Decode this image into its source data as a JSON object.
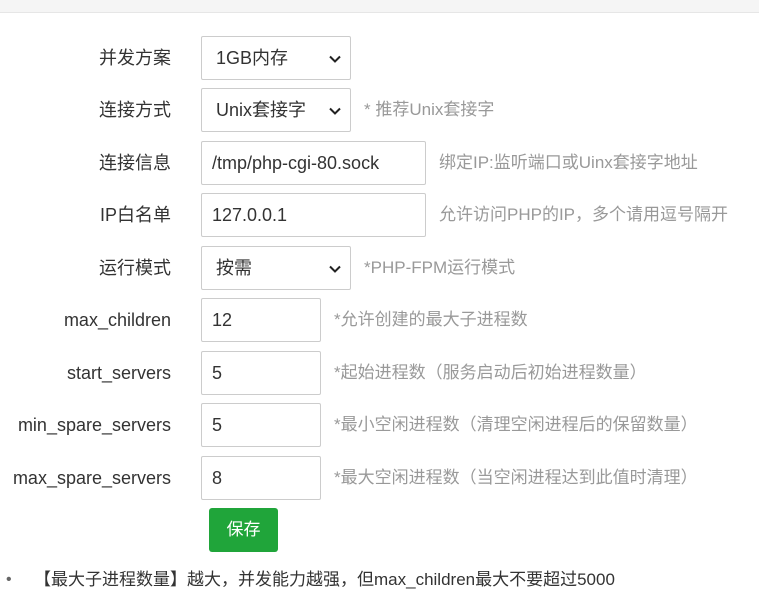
{
  "form": {
    "concurrency": {
      "label": "并发方案",
      "value": "1GB内存"
    },
    "connection_method": {
      "label": "连接方式",
      "value": "Unix套接字",
      "hint": "* 推荐Unix套接字"
    },
    "connection_info": {
      "label": "连接信息",
      "value": "/tmp/php-cgi-80.sock",
      "hint": "绑定IP:监听端口或Uinx套接字地址"
    },
    "ip_whitelist": {
      "label": "IP白名单",
      "value": "127.0.0.1",
      "hint": "允许访问PHP的IP，多个请用逗号隔开"
    },
    "run_mode": {
      "label": "运行模式",
      "value": "按需",
      "hint": "*PHP-FPM运行模式"
    },
    "max_children": {
      "label": "max_children",
      "value": "12",
      "hint": "*允许创建的最大子进程数"
    },
    "start_servers": {
      "label": "start_servers",
      "value": "5",
      "hint": "*起始进程数（服务启动后初始进程数量）"
    },
    "min_spare_servers": {
      "label": "min_spare_servers",
      "value": "5",
      "hint": "*最小空闲进程数（清理空闲进程后的保留数量）"
    },
    "max_spare_servers": {
      "label": "max_spare_servers",
      "value": "8",
      "hint": "*最大空闲进程数（当空闲进程达到此值时清理）"
    },
    "save_label": "保存"
  },
  "notes": [
    "【最大子进程数量】越大，并发能力越强，但max_children最大不要超过5000"
  ],
  "colors": {
    "primary_button": "#20a53a",
    "hint_text": "#999999",
    "border": "#cccccc"
  }
}
